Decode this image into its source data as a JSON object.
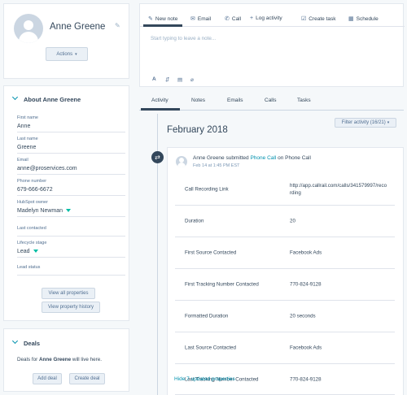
{
  "contact": {
    "name": "Anne Greene",
    "actions_label": "Actions"
  },
  "about": {
    "title": "About Anne Greene",
    "fields": [
      {
        "label": "First name",
        "value": "Anne"
      },
      {
        "label": "Last name",
        "value": "Greene"
      },
      {
        "label": "Email",
        "value": "anne@proservices.com"
      },
      {
        "label": "Phone number",
        "value": "679-666-6672"
      },
      {
        "label": "HubSpot owner",
        "value": "Madelyn Newman"
      },
      {
        "label": "Last contacted",
        "value": ""
      },
      {
        "label": "Lifecycle stage",
        "value": "Lead"
      },
      {
        "label": "Lead status",
        "value": ""
      }
    ],
    "view_all_label": "View all properties",
    "view_history_label": "View property history"
  },
  "deals": {
    "title": "Deals",
    "text_prefix": "Deals for ",
    "text_name": "Anne Greene",
    "text_suffix": " will live here.",
    "add_label": "Add deal",
    "create_label": "Create deal"
  },
  "composer": {
    "tabs": [
      {
        "label": "New note",
        "icon": "edit-icon"
      },
      {
        "label": "Email",
        "icon": "email-icon"
      },
      {
        "label": "Call",
        "icon": "phone-icon"
      },
      {
        "label": "Log activity",
        "icon": "plus-icon"
      },
      {
        "label": "Create task",
        "icon": "task-icon"
      },
      {
        "label": "Schedule",
        "icon": "calendar-icon"
      }
    ],
    "placeholder": "Start typing to leave a note..."
  },
  "timeline": {
    "tabs": [
      "Activity",
      "Notes",
      "Emails",
      "Calls",
      "Tasks"
    ],
    "filter_label": "Filter activity (16/21)",
    "month": "February 2018",
    "event": {
      "actor": "Anne Greene",
      "verb": " submitted ",
      "link": "Phone Call",
      "suffix": " on Phone Call",
      "time": "Feb 14 at 1:45 PM EST"
    },
    "properties": [
      {
        "key": "Call Recording Link",
        "value": "http://app.callrail.com/calls/341579997/recording"
      },
      {
        "key": "Duration",
        "value": "20"
      },
      {
        "key": "First Source Contacted",
        "value": "Facebook Ads"
      },
      {
        "key": "First Tracking Number Contacted",
        "value": "770-824-9128"
      },
      {
        "key": "Formatted Duration",
        "value": "20 seconds"
      },
      {
        "key": "Last Source Contacted",
        "value": "Facebook Ads"
      },
      {
        "key": "Last Tracking Number Contacted",
        "value": "770-824-9128"
      }
    ],
    "hide_link": "Hide 7 updated properties"
  },
  "colors": {
    "accent": "#0091ae",
    "teal": "#00bda5",
    "text": "#33475b",
    "border": "#dfe3eb"
  }
}
